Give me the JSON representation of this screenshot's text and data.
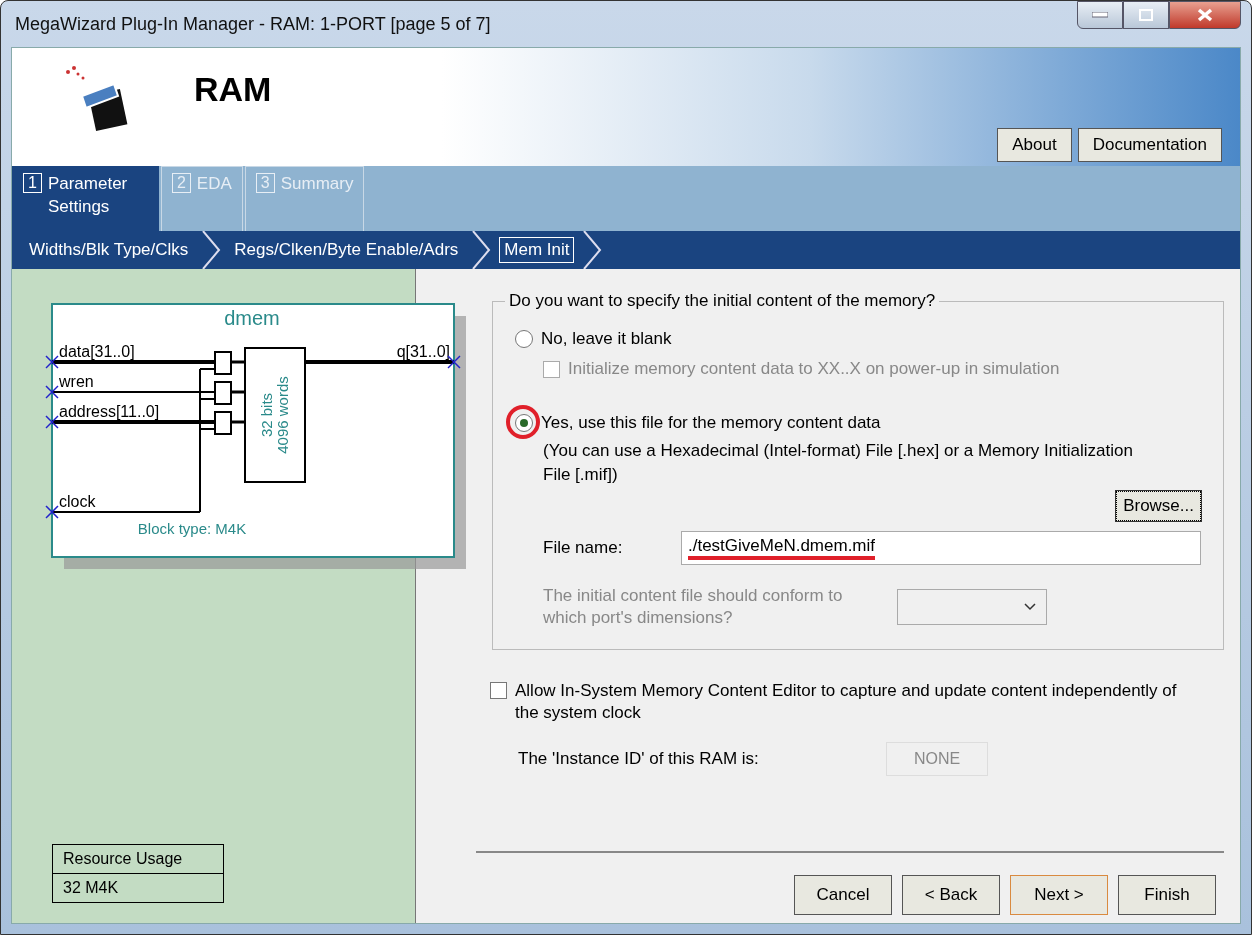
{
  "window": {
    "title": "MegaWizard Plug-In Manager - RAM: 1-PORT [page 5 of 7]"
  },
  "header": {
    "title": "RAM",
    "buttons": [
      "About",
      "Documentation"
    ]
  },
  "tabs": [
    {
      "number": "1",
      "label": "Parameter Settings",
      "selected": true
    },
    {
      "number": "2",
      "label": "EDA",
      "selected": false
    },
    {
      "number": "3",
      "label": "Summary",
      "selected": false
    }
  ],
  "steps": [
    {
      "label": "Widths/Blk Type/Clks",
      "selected": false
    },
    {
      "label": "Regs/Clken/Byte Enable/Adrs",
      "selected": false
    },
    {
      "label": "Mem Init",
      "selected": true
    }
  ],
  "diagram": {
    "name": "dmem",
    "inputs": [
      "data[31..0]",
      "wren",
      "address[11..0]",
      "clock"
    ],
    "output": "q[31..0]",
    "width_label": "32 bits",
    "depth_label": "4096 words",
    "block_type": "Block type: M4K"
  },
  "resource_usage": {
    "header": "Resource Usage",
    "value": "32 M4K"
  },
  "init_group": {
    "legend": "Do you want to specify the initial content of the memory?",
    "options": [
      {
        "label": "No, leave it blank",
        "selected": false,
        "circled": false
      },
      {
        "label": "Yes, use this file for the memory content data",
        "selected": true,
        "circled": true
      }
    ],
    "xx_checkbox": {
      "label": "Initialize memory content data to XX..X on power-up in simulation",
      "checked": false,
      "disabled": true
    },
    "hint": "(You can use a Hexadecimal (Intel-format) File [.hex] or a Memory Initialization File [.mif])",
    "browse_button": "Browse...",
    "file_label": "File name:",
    "file_value": "./testGiveMeN.dmem.mif",
    "file_underlined": true,
    "port_label": "The initial content file should conform to which port's dimensions?",
    "port_disabled": true
  },
  "editor_checkbox": {
    "label": "Allow In-System Memory Content Editor to capture and update content independently of the system clock",
    "checked": false
  },
  "instance": {
    "label": "The 'Instance ID' of this RAM is:",
    "value": "NONE",
    "disabled": true
  },
  "footer_buttons": [
    {
      "label": "Cancel",
      "default": false
    },
    {
      "label": "< Back",
      "default": false
    },
    {
      "label": "Next >",
      "default": true
    },
    {
      "label": "Finish",
      "default": false
    }
  ]
}
